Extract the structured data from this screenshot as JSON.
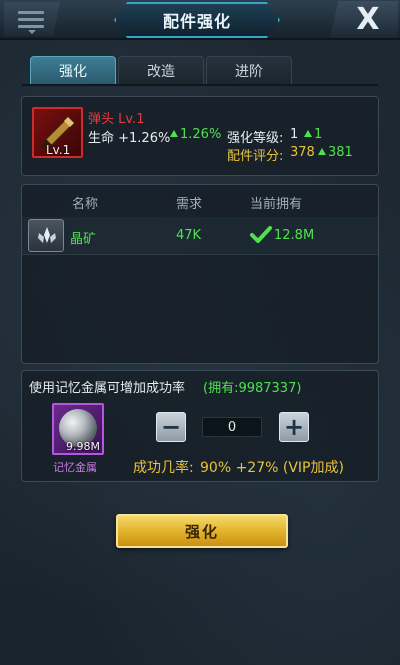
{
  "header": {
    "title": "配件强化",
    "close_label": "X"
  },
  "tabs": [
    {
      "label": "强化",
      "active": true
    },
    {
      "label": "改造",
      "active": false
    },
    {
      "label": "进阶",
      "active": false
    }
  ],
  "item": {
    "icon": "bullet-icon",
    "level_badge": "Lv.1",
    "name": "弹头 Lv.1",
    "life_label": "生命 +1.26%",
    "life_gain": "1.26%",
    "enhance_level_label": "强化等级:",
    "enhance_level_value": "1",
    "enhance_level_gain": "1",
    "rating_label": "配件评分:",
    "rating_value": "378",
    "rating_gain": "381"
  },
  "requirements": {
    "columns": [
      "名称",
      "需求",
      "当前拥有"
    ],
    "rows": [
      {
        "icon": "crystal-icon",
        "name": "晶矿",
        "need": "47K",
        "owned": "12.8M",
        "met": true
      }
    ]
  },
  "boost": {
    "description": "使用记忆金属可增加成功率",
    "owned_text": "(拥有:9987337)",
    "item_icon": "memory-metal-icon",
    "item_amount": "9.98M",
    "item_name": "记忆金属",
    "quantity": "0",
    "success_label": "成功几率:",
    "success_value": "90% +27% (VIP加成)"
  },
  "actions": {
    "enhance_label": "强化"
  },
  "colors": {
    "accent_cyan": "#3aa4c8",
    "red": "#e23d3d",
    "green": "#4fe24f",
    "yellow": "#e8c23a",
    "button_gold": "#e3b42c"
  }
}
